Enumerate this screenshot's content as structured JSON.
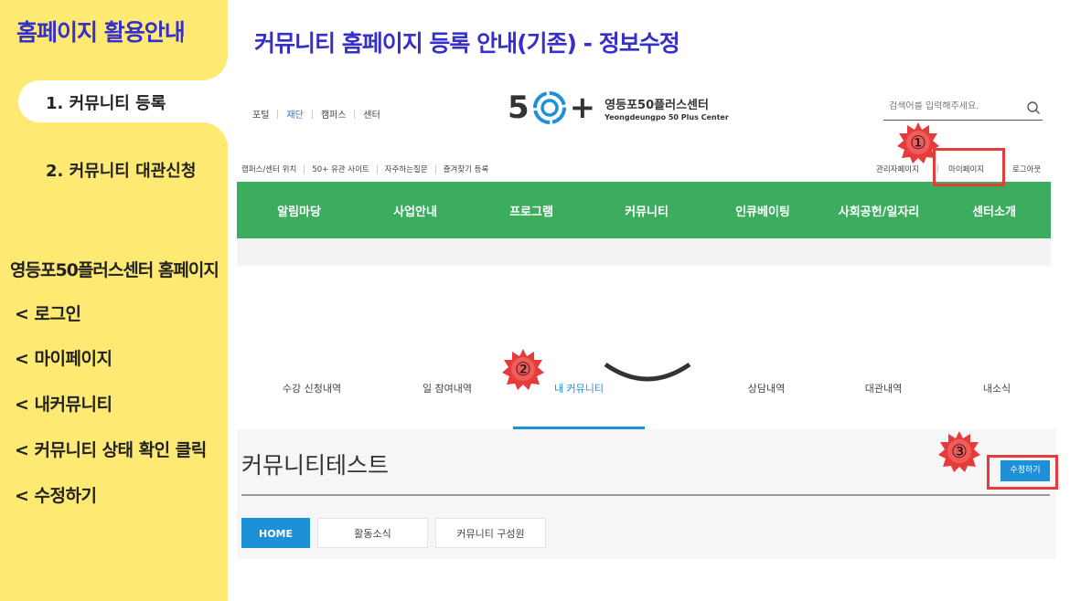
{
  "sidebar": {
    "title": "홈페이지 활용안내",
    "item1": "1. 커뮤니티 등록",
    "item2": "2. 커뮤니티 대관신청",
    "subtitle": "영등포50플러스센터 홈페이지",
    "steps": [
      "< 로그인",
      "< 마이페이지",
      "< 내커뮤니티",
      "< 커뮤니티 상태 확인 클릭",
      "< 수정하기"
    ]
  },
  "slide": {
    "title": "커뮤니티 홈페이지 등록 안내(기존) - 정보수정"
  },
  "site": {
    "top_links": [
      "포털",
      "재단",
      "캠퍼스",
      "센터"
    ],
    "logo": {
      "num": "5",
      "plus": "+",
      "kr": "영등포50플러스센터",
      "en": "Yeongdeungpo 50 Plus Center"
    },
    "search_placeholder": "검색어를 입력해주세요.",
    "sub_links": [
      "캠퍼스/센터 위치",
      "50+ 유관 사이트",
      "자주하는질문",
      "즐겨찾기 등록"
    ],
    "util_links": [
      "관리자페이지",
      "마이페이지",
      "로그아웃"
    ],
    "gnb": [
      "알림마당",
      "사업안내",
      "프로그램",
      "커뮤니티",
      "인큐베이팅",
      "사회공헌/일자리",
      "센터소개"
    ],
    "mypage_tabs": [
      "수강 신청내역",
      "일 참여내역",
      "내 커뮤니티",
      "상담내역",
      "대관내역",
      "내소식"
    ],
    "community_name": "커뮤니티테스트",
    "edit_button": "수정하기",
    "sub_tabs": [
      "HOME",
      "활동소식",
      "커뮤니티 구성원"
    ]
  },
  "annotations": {
    "badges": [
      "①",
      "②",
      "③"
    ]
  },
  "colors": {
    "sidebar": "#fee972",
    "title": "#3730c8",
    "gnb": "#3cad5e",
    "accent": "#1e90d8",
    "highlight": "#e53b3b"
  }
}
